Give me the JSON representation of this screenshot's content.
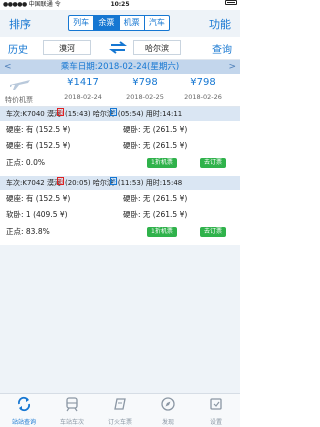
{
  "status_bar": {
    "carrier": "中国联通",
    "network": "令",
    "time": "10:25",
    "battery": ""
  },
  "header": {
    "left_label": "排序",
    "right_label": "功能",
    "tabs": [
      {
        "label": "列车",
        "active": false
      },
      {
        "label": "余票",
        "active": true
      },
      {
        "label": "机票",
        "active": false
      },
      {
        "label": "汽车",
        "active": false
      }
    ]
  },
  "search": {
    "history_label": "历史",
    "from": "漠河",
    "to": "哈尔滨",
    "query_label": "查询"
  },
  "date_bar": {
    "text": "乘车日期:2018-02-24(星期六)",
    "prev": "<",
    "next": ">"
  },
  "flight": {
    "label": "特价机票",
    "prices": [
      {
        "price": "¥1417",
        "date": "2018-02-24"
      },
      {
        "price": "¥798",
        "date": "2018-02-25"
      },
      {
        "price": "¥798",
        "date": "2018-02-26"
      }
    ]
  },
  "trains": [
    {
      "title_prefix": "车次:K7040 漠河",
      "start_tag": "始",
      "depart": "(15:43) 哈尔滨",
      "pass_tag": "终",
      "arrive": "(05:54) 用时:14:11",
      "rows": [
        [
          "硬座: 有 (152.5 ¥)",
          "硬卧: 无 (261.5 ¥)"
        ],
        [
          "硬座: 有 (152.5 ¥)",
          "硬卧: 无 (261.5 ¥)"
        ]
      ],
      "punctual": "正点: 0.0%",
      "discount_btn": "1折机票",
      "order_btn": "去订票"
    },
    {
      "title_prefix": "车次:K7042 漠河",
      "start_tag": "始",
      "depart": "(20:05) 哈尔滨",
      "pass_tag": "终",
      "arrive": "(11:53) 用时:15:48",
      "rows": [
        [
          "硬座: 有 (152.5 ¥)",
          "硬卧: 无 (261.5 ¥)"
        ],
        [
          "软卧: 1 (409.5 ¥)",
          "硬卧: 无 (261.5 ¥)"
        ]
      ],
      "punctual": "正点: 83.8%",
      "discount_btn": "1折机票",
      "order_btn": "去订票"
    }
  ],
  "tab_bar": [
    {
      "label": "站站查询",
      "icon": "refresh-icon",
      "active": true
    },
    {
      "label": "车站车次",
      "icon": "train-icon",
      "active": false
    },
    {
      "label": "订火车票",
      "icon": "ticket-icon",
      "active": false
    },
    {
      "label": "发现",
      "icon": "compass-icon",
      "active": false
    },
    {
      "label": "设置",
      "icon": "settings-icon",
      "active": false
    }
  ],
  "colors": {
    "accent": "#1677d2",
    "date_bar": "#c3d6ec",
    "green": "#2fb24b",
    "start_tag": "#dd2222"
  }
}
